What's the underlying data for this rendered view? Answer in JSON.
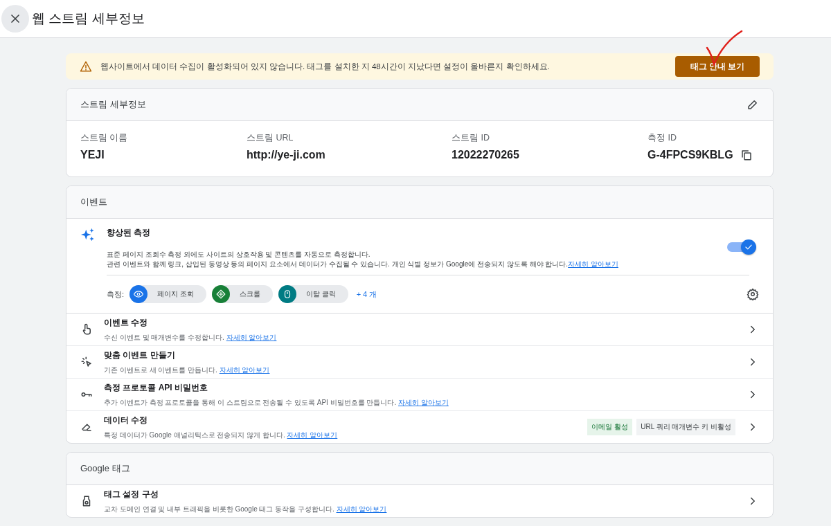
{
  "header": {
    "title": "웹 스트림 세부정보"
  },
  "banner": {
    "message": "웹사이트에서 데이터 수집이 활성화되어 있지 않습니다. 태그를 설치한 지 48시간이 지났다면 설정이 올바른지 확인하세요.",
    "button": "태그 안내 보기"
  },
  "stream_details": {
    "title": "스트림 세부정보",
    "fields": [
      {
        "label": "스트림 이름",
        "value": "YEJI"
      },
      {
        "label": "스트림 URL",
        "value": "http://ye-ji.com"
      },
      {
        "label": "스트림 ID",
        "value": "12022270265"
      },
      {
        "label": "측정 ID",
        "value": "G-4FPCS9KBLG",
        "copyable": true
      }
    ]
  },
  "events": {
    "title": "이벤트",
    "enhanced": {
      "title": "향상된 측정",
      "line1": "표준 페이지 조회수 측정 외에도 사이트의 상호작용 및 콘텐츠를 자동으로 측정합니다.",
      "line2": "관련 이벤트와 함께 링크, 삽입된 동영상 등의 페이지 요소에서 데이터가 수집될 수 있습니다. 개인 식별 정보가 Google에 전송되지 않도록 해야 합니다.",
      "link": "자세히 알아보기",
      "on": true,
      "measure_label": "측정:",
      "chips": [
        {
          "label": "페이지 조회",
          "color": "#1a73e8"
        },
        {
          "label": "스크롤",
          "color": "#188038"
        },
        {
          "label": "이탈 클릭",
          "color": "#007b83"
        }
      ],
      "more": "+ 4 개"
    },
    "rows": [
      {
        "title": "이벤트 수정",
        "desc": "수신 이벤트 및 매개변수를 수정합니다.",
        "link": "자세히 알아보기"
      },
      {
        "title": "맞춤 이벤트 만들기",
        "desc": "기존 이벤트로 새 이벤트를 만듭니다.",
        "link": "자세히 알아보기"
      },
      {
        "title": "측정 프로토콜 API 비밀번호",
        "desc": "추가 이벤트가 측정 프로토콜을 통해 이 스트림으로 전송될 수 있도록 API 비밀번호를 만듭니다.",
        "link": "자세히 알아보기"
      },
      {
        "title": "데이터 수정",
        "desc": "특정 데이터가 Google 애널리틱스로 전송되지 않게 합니다.",
        "link": "자세히 알아보기",
        "tags": [
          {
            "label": "이메일 활성",
            "on": true
          },
          {
            "label": "URL 쿼리 매개변수 키 비활성",
            "on": false
          }
        ]
      }
    ]
  },
  "google_tag": {
    "title": "Google 태그",
    "rows": [
      {
        "title": "태그 설정 구성",
        "desc": "교차 도메인 연결 및 내부 트래픽을 비롯한 Google 태그 동작을 구성합니다.",
        "link": "자세히 알아보기"
      }
    ]
  }
}
